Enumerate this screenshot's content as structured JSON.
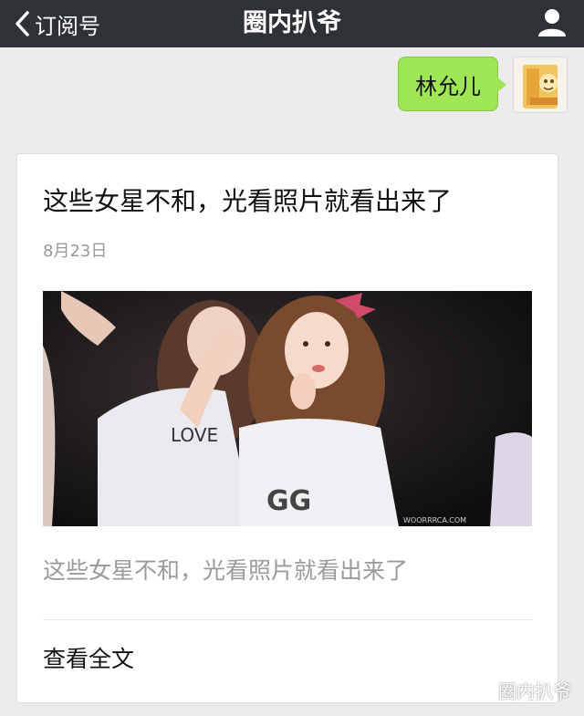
{
  "navbar": {
    "back_label": "订阅号",
    "title": "圈内扒爷",
    "back_icon": "chevron-left-icon",
    "user_icon": "user-icon"
  },
  "message": {
    "text": "林允儿",
    "avatar_icon": "cartoon-avatar"
  },
  "article": {
    "title": "这些女星不和，光看照片就看出来了",
    "date": "8月23日",
    "image_caption": "WOORRRCA.COM",
    "image_shirt_text_1": "LOVE",
    "image_shirt_text_2": "GG",
    "description": "这些女星不和，光看照片就看出来了",
    "read_more": "查看全文"
  },
  "watermark": {
    "text": "圈内扒爷",
    "icon": "wechat-logo-icon"
  },
  "colors": {
    "navbar_bg": "#2e3135",
    "page_bg": "#ebebeb",
    "bubble_green": "#9ee654",
    "muted_text": "#9a9a9a"
  }
}
